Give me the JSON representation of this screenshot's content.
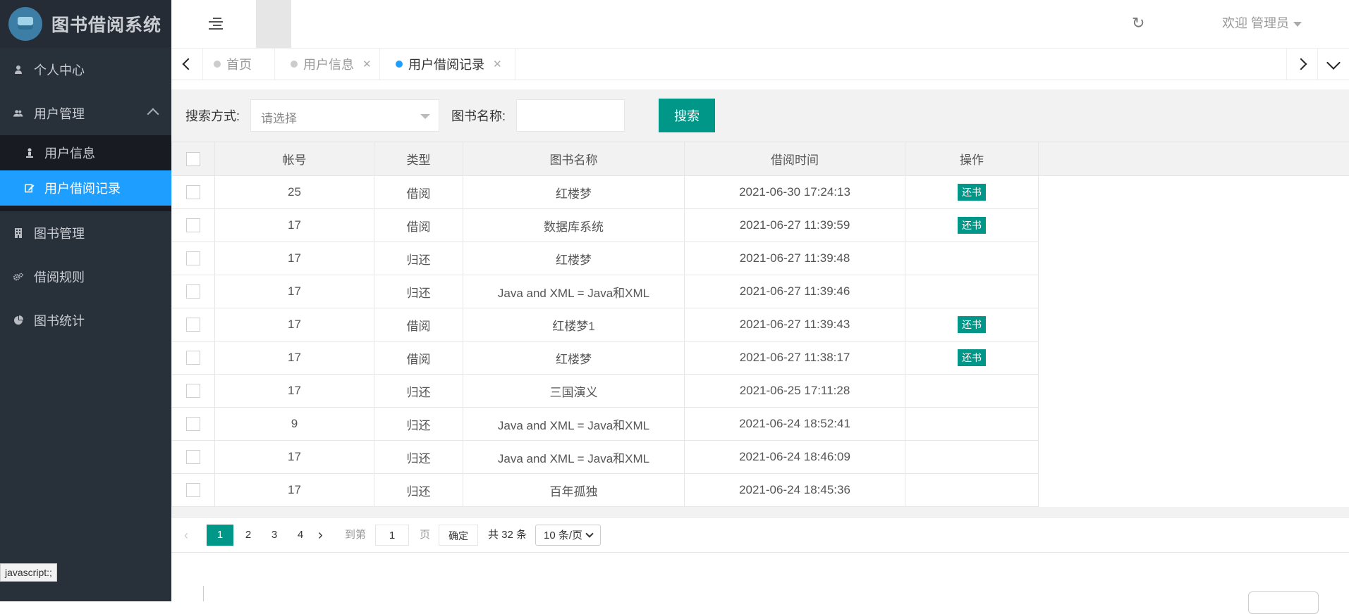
{
  "app": {
    "title": "图书借阅系统"
  },
  "sidebar": {
    "items": [
      {
        "label": "个人中心",
        "icon": "user-icon"
      },
      {
        "label": "用户管理",
        "icon": "users-icon",
        "expanded": true,
        "children": [
          {
            "label": "用户信息",
            "icon": "person-icon"
          },
          {
            "label": "用户借阅记录",
            "icon": "edit-icon",
            "active": true
          }
        ]
      },
      {
        "label": "图书管理",
        "icon": "building-icon"
      },
      {
        "label": "借阅规则",
        "icon": "gears-icon"
      },
      {
        "label": "图书统计",
        "icon": "pie-chart-icon"
      }
    ]
  },
  "header": {
    "welcome": "欢迎 管理员"
  },
  "tabs": [
    {
      "label": "首页",
      "closable": false
    },
    {
      "label": "用户信息",
      "closable": true
    },
    {
      "label": "用户借阅记录",
      "closable": true,
      "active": true
    }
  ],
  "search": {
    "method_label": "搜索方式:",
    "method_placeholder": "请选择",
    "book_label": "图书名称:",
    "book_value": "",
    "button": "搜索"
  },
  "table": {
    "columns": [
      "帐号",
      "类型",
      "图书名称",
      "借阅时间",
      "操作"
    ],
    "action_label": "还书",
    "rows": [
      {
        "account": "25",
        "type": "借阅",
        "book": "红楼梦",
        "time": "2021-06-30 17:24:13",
        "action": true
      },
      {
        "account": "17",
        "type": "借阅",
        "book": "数据库系统",
        "time": "2021-06-27 11:39:59",
        "action": true
      },
      {
        "account": "17",
        "type": "归还",
        "book": "红楼梦",
        "time": "2021-06-27 11:39:48",
        "action": false
      },
      {
        "account": "17",
        "type": "归还",
        "book": "Java and XML = Java和XML",
        "time": "2021-06-27 11:39:46",
        "action": false
      },
      {
        "account": "17",
        "type": "借阅",
        "book": "红楼梦1",
        "time": "2021-06-27 11:39:43",
        "action": true
      },
      {
        "account": "17",
        "type": "借阅",
        "book": "红楼梦",
        "time": "2021-06-27 11:38:17",
        "action": true
      },
      {
        "account": "17",
        "type": "归还",
        "book": "三国演义",
        "time": "2021-06-25 17:11:28",
        "action": false
      },
      {
        "account": "9",
        "type": "归还",
        "book": "Java and XML = Java和XML",
        "time": "2021-06-24 18:52:41",
        "action": false
      },
      {
        "account": "17",
        "type": "归还",
        "book": "Java and XML = Java和XML",
        "time": "2021-06-24 18:46:09",
        "action": false
      },
      {
        "account": "17",
        "type": "归还",
        "book": "百年孤独",
        "time": "2021-06-24 18:45:36",
        "action": false
      }
    ]
  },
  "pager": {
    "pages": [
      "1",
      "2",
      "3",
      "4"
    ],
    "current": "1",
    "goto_prefix": "到第",
    "goto_value": "1",
    "goto_suffix": "页",
    "confirm": "确定",
    "total": "共 32 条",
    "page_size": "10 条/页"
  },
  "statusbar": {
    "tooltip": "javascript:;"
  },
  "colors": {
    "accent": "#009688",
    "active_nav": "#1e9fff",
    "sidebar_bg": "#28303a",
    "borrow": "#ff2b2b",
    "return": "#2aa62a"
  }
}
